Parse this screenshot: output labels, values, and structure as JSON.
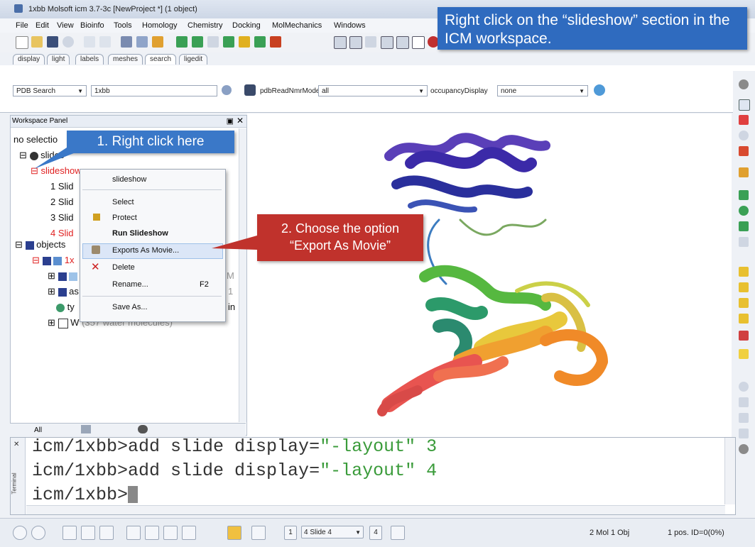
{
  "window": {
    "title": "1xbb Molsoft icm 3.7-3c  [NewProject *] (1 object)"
  },
  "menu": [
    "File",
    "Edit",
    "View",
    "Bioinfo",
    "Tools",
    "Homology",
    "Chemistry",
    "Docking",
    "MolMechanics",
    "Windows"
  ],
  "tabs": [
    "display",
    "light",
    "labels",
    "meshes",
    "search",
    "ligedit"
  ],
  "search": {
    "source": "PDB Search",
    "query": "1xbb",
    "option1_label": "pdbReadNmrModels",
    "option1_value": "all",
    "option2_label": "occupancyDisplay",
    "option2_value": "none"
  },
  "workspace": {
    "title": "Workspace Panel",
    "no_selection": "no selectio",
    "tree": {
      "slides_root": "slides",
      "slideshow": "slideshow",
      "slides": [
        "1 Slid",
        "2 Slid",
        "3 Slid",
        "4 Slid"
      ],
      "objects": "objects",
      "obj_1": "1x",
      "obj_as": "as",
      "obj_ty": "ty",
      "obj_w": "W",
      "obj_w_desc": "(357 water molecules)",
      "frag_m": "M",
      "frag_1": "1",
      "frag_in": "in"
    },
    "footer_tabs": [
      "All",
      "",
      ""
    ]
  },
  "context_menu": {
    "header": "slideshow",
    "items": [
      {
        "label": "Select",
        "shortcut": ""
      },
      {
        "label": "Protect",
        "shortcut": ""
      },
      {
        "label": "Run Slideshow",
        "shortcut": ""
      },
      {
        "label": "Exports As Movie...",
        "shortcut": ""
      },
      {
        "label": "Delete",
        "shortcut": ""
      },
      {
        "label": "Rename...",
        "shortcut": "F2"
      },
      {
        "label": "Save As...",
        "shortcut": ""
      }
    ]
  },
  "terminal": {
    "lines": [
      {
        "prefix": "icm/1xbb>add slide display=",
        "arg": "\"-layout\" 3"
      },
      {
        "prefix": "icm/1xbb>add slide display=",
        "arg": "\"-layout\" 4"
      },
      {
        "prefix": "icm/1xbb>",
        "arg": ""
      }
    ],
    "side_label": "Terminal"
  },
  "statusbar": {
    "page_start": "1",
    "slide_select": "4 Slide 4",
    "page_count": "4",
    "objects": "2 Mol 1 Obj",
    "position": "1 pos. ID=0(0%)"
  },
  "callouts": {
    "top": "Right click on the “slideshow” section in the ICM workspace.",
    "step1": "1. Right click here",
    "step2_line1": "2. Choose the option",
    "step2_line2": "“Export As Movie”"
  },
  "colors": {
    "callout_blue": "#2f6bbf",
    "callout_red": "#c0322c",
    "tree_red": "#e02020",
    "term_green": "#3a9b3a"
  }
}
